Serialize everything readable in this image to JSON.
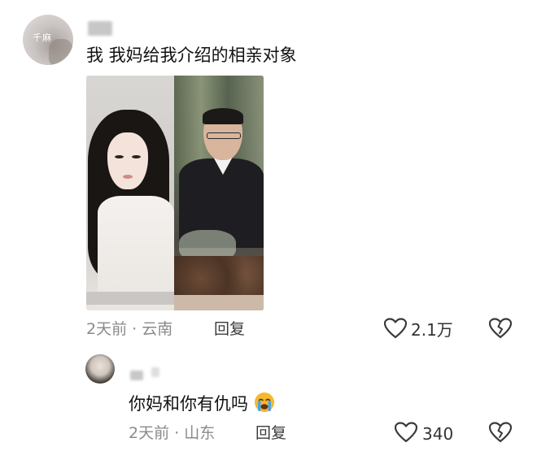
{
  "comment": {
    "avatar_text": "千麻",
    "text": "我 我妈给我介绍的相亲对象",
    "time": "2天前",
    "separator": "·",
    "location": "云南",
    "reply_label": "回复",
    "like_count": "2.1万",
    "image_icon": "photo"
  },
  "reply": {
    "text": "你妈和你有仇吗",
    "emoji_icon": "loudly-crying-face-icon",
    "time": "2天前",
    "separator": "·",
    "location": "山东",
    "reply_label": "回复",
    "like_count": "340"
  },
  "icons": {
    "like": "heart-outline-icon",
    "dislike": "broken-heart-icon"
  },
  "colors": {
    "meta_gray": "#8a8a8a",
    "text": "#121212",
    "emoji_yellow": "#f5b82e",
    "emoji_tear": "#4aa3e8"
  }
}
